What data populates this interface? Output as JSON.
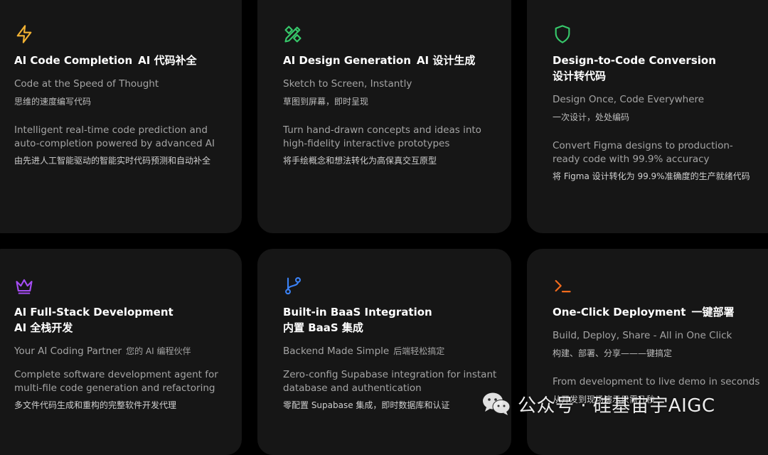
{
  "cards": [
    {
      "icon": "lightning-bolt-icon",
      "icon_color": "#f2b233",
      "title_en": "AI Code Completion",
      "title_zh": "AI 代码补全",
      "tagline_en": "Code at the Speed of Thought",
      "tagline_zh": "思维的速度编写代码",
      "desc_en": "Intelligent real-time code prediction and auto-completion powered by advanced AI",
      "desc_zh": "由先进人工智能驱动的智能实时代码预测和自动补全"
    },
    {
      "icon": "design-tools-icon",
      "icon_color": "#37c96b",
      "title_en": "AI Design Generation",
      "title_zh": "AI 设计生成",
      "tagline_en": "Sketch to Screen, Instantly",
      "tagline_zh": "草图到屏幕，即时呈现",
      "desc_en": "Turn hand-drawn concepts and ideas into high-fidelity interactive prototypes",
      "desc_zh": "将手绘概念和想法转化为高保真交互原型"
    },
    {
      "icon": "shield-icon",
      "icon_color": "#37c96b",
      "title_en": "Design-to-Code Conversion",
      "title_zh": "设计转代码",
      "tagline_en": "Design Once, Code Everywhere",
      "tagline_zh": "一次设计，处处编码",
      "desc_en": "Convert Figma designs to production-ready code with 99.9% accuracy",
      "desc_zh": "将 Figma 设计转化为 99.9%准确度的生产就绪代码"
    },
    {
      "icon": "crown-icon",
      "icon_color": "#a64df5",
      "title_en": "AI Full-Stack Development",
      "title_zh": "AI 全栈开发",
      "tagline_en": "Your AI Coding Partner",
      "tagline_zh": "您的 AI 编程伙伴",
      "desc_en": "Complete software development agent for multi-file code generation and refactoring",
      "desc_zh": "多文件代码生成和重构的完整软件开发代理"
    },
    {
      "icon": "git-branch-icon",
      "icon_color": "#3b82f6",
      "title_en": "Built-in BaaS Integration",
      "title_zh": "内置 BaaS 集成",
      "tagline_en": "Backend Made Simple",
      "tagline_zh": "后端轻松搞定",
      "desc_en": "Zero-config Supabase integration for instant database and authentication",
      "desc_zh": "零配置 Supabase 集成，即时数据库和认证"
    },
    {
      "icon": "terminal-icon",
      "icon_color": "#f26b1d",
      "title_en": "One-Click Deployment",
      "title_zh": "一键部署",
      "tagline_en": "Build, Deploy, Share - All in One Click",
      "tagline_zh": "构建、部署、分享———键搞定",
      "desc_en": "From development to live demo in seconds",
      "desc_zh": "从开发到现场演示只需几秒"
    }
  ],
  "watermark": {
    "icon": "wechat-icon",
    "text": "公众号 · 硅基宙宇AIGC"
  }
}
